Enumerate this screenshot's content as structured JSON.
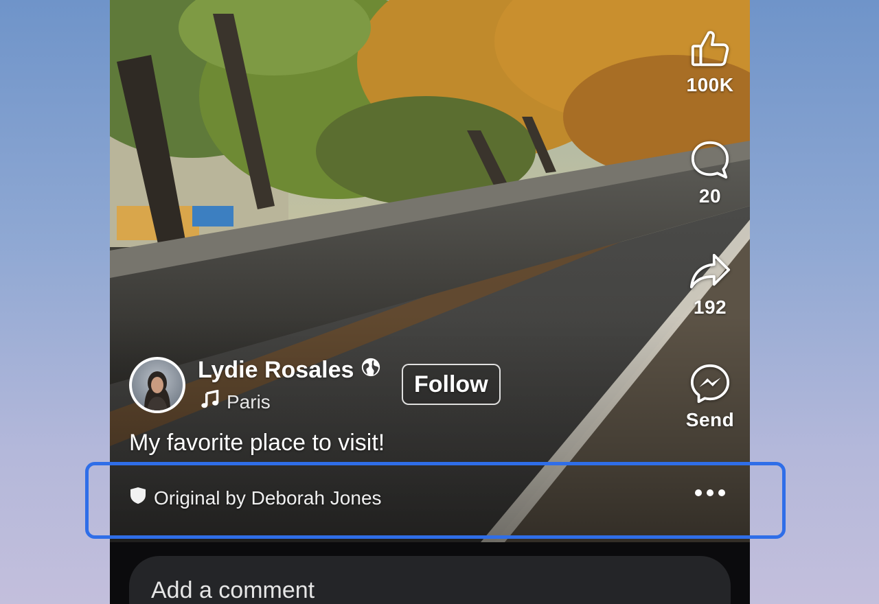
{
  "actions": {
    "like": {
      "icon": "thumbs-up-icon",
      "count": "100K"
    },
    "comment": {
      "icon": "comment-bubble-icon",
      "count": "20"
    },
    "share": {
      "icon": "share-arrow-icon",
      "count": "192"
    },
    "send": {
      "icon": "messenger-icon",
      "label": "Send"
    }
  },
  "author": {
    "name": "Lydie Rosales",
    "audience_icon": "globe-icon",
    "music_icon": "music-note-icon",
    "music": "Paris",
    "follow_label": "Follow"
  },
  "caption": "My favorite place to visit!",
  "attribution": {
    "icon": "shield-icon",
    "text": "Original by Deborah Jones",
    "more_icon": "more-dots-icon"
  },
  "comment": {
    "placeholder": "Add a comment"
  },
  "colors": {
    "highlight": "#2f6ee8",
    "comment_bar": "#242528",
    "background_top": "#6f94c9",
    "background_bottom": "#c3bfdc"
  }
}
